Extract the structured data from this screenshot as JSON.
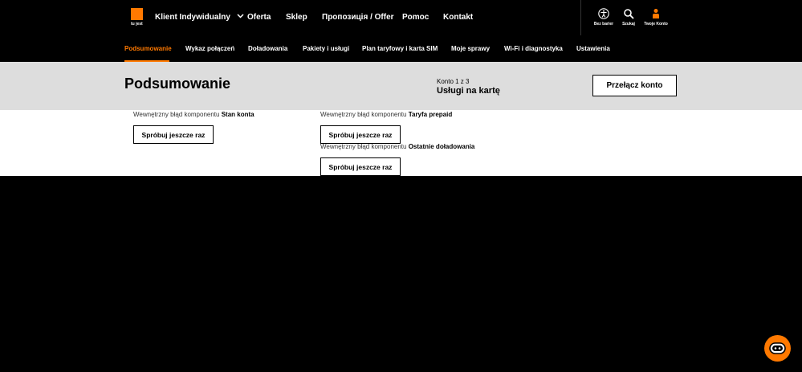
{
  "brand": {
    "tagline": "tu jest",
    "color": "#ff7900"
  },
  "main_nav": {
    "segment": "Klient Indywidualny",
    "items": [
      "Oferta",
      "Sklep",
      "Пропозиція / Offer",
      "Pomoc",
      "Kontakt"
    ]
  },
  "utility": {
    "accessibility": "Bez barier",
    "search": "Szukaj",
    "account": "Twoje Konto"
  },
  "sub_nav": {
    "active": "Podsumowanie",
    "items": [
      "Podsumowanie",
      "Wykaz połączeń",
      "Doładowania",
      "Pakiety i usługi",
      "Plan taryfowy i karta SIM",
      "Moje sprawy",
      "Wi-Fi i diagnostyka",
      "Ustawienia"
    ]
  },
  "header": {
    "title": "Podsumowanie",
    "account_counter": "Konto 1 z 3",
    "account_name": "Usługi na kartę",
    "switch_label": "Przełącz konto"
  },
  "errors": [
    {
      "prefix": "Wewnętrzny błąd komponentu",
      "component": "Stan konta",
      "retry": "Spróbuj jeszcze raz"
    },
    {
      "prefix": "Wewnętrzny błąd komponentu",
      "component": "Taryfa prepaid",
      "retry": "Spróbuj jeszcze raz"
    },
    {
      "prefix": "Wewnętrzny błąd komponentu",
      "component": "Ostatnie doładowania",
      "retry": "Spróbuj jeszcze raz"
    }
  ]
}
